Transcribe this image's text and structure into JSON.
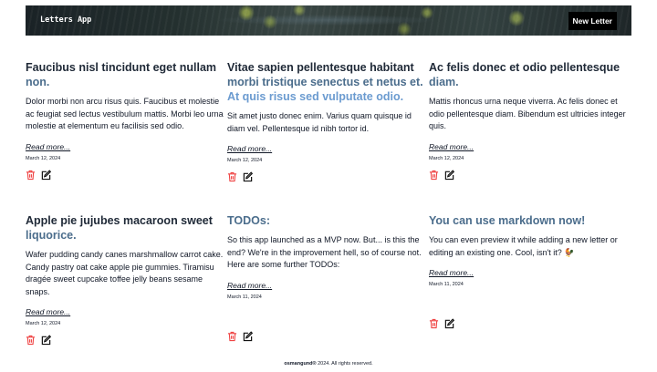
{
  "header": {
    "brand": "Letters App",
    "new_letter_label": "New Letter"
  },
  "letters": [
    {
      "title_lines": [
        {
          "text": "Faucibus nisl tincidunt eget nullam",
          "tone": "dark"
        },
        {
          "text": "non.",
          "tone": "blue"
        }
      ],
      "body": "Dolor morbi non arcu risus quis. Faucibus et molestie ac feugiat sed lectus vestibulum mattis. Morbi leo urna molestie at elementum eu facilisis sed odio.",
      "read_more": "Read more...",
      "date": "March 12, 2024",
      "delete_icon": "trash-icon",
      "edit_icon": "edit-icon"
    },
    {
      "title_lines": [
        {
          "text": "Vitae sapien pellentesque habitant",
          "tone": "dark"
        },
        {
          "text": "morbi tristique senectus et netus et.",
          "tone": "blue"
        },
        {
          "text": "At quis risus sed vulputate odio.",
          "tone": "light"
        }
      ],
      "body": "Sit amet justo donec enim. Varius quam quisque id diam vel. Pellentesque id nibh tortor id.",
      "read_more": "Read more...",
      "date": "March 12, 2024",
      "delete_icon": "trash-icon",
      "edit_icon": "edit-icon"
    },
    {
      "title_lines": [
        {
          "text": "Ac felis donec et odio pellentesque",
          "tone": "dark"
        },
        {
          "text": "diam.",
          "tone": "blue"
        }
      ],
      "body": "Mattis rhoncus urna neque viverra. Ac felis donec et odio pellentesque diam. Bibendum est ultricies integer quis.",
      "read_more": "Read more...",
      "date": "March 12, 2024",
      "delete_icon": "trash-icon",
      "edit_icon": "edit-icon"
    },
    {
      "title_lines": [
        {
          "text": "Apple pie jujubes macaroon sweet",
          "tone": "dark"
        },
        {
          "text": "liquorice.",
          "tone": "blue"
        }
      ],
      "body": "Wafer pudding candy canes marshmallow carrot cake. Candy pastry oat cake apple pie gummies. Tiramisu dragée sweet cupcake toffee jelly beans sesame snaps.",
      "read_more": "Read more...",
      "date": "March 12, 2024",
      "delete_icon": "trash-icon",
      "edit_icon": "edit-icon"
    },
    {
      "title_lines": [
        {
          "text": "TODOs:",
          "tone": "blue"
        }
      ],
      "body": "So this app launched as a MVP now. But... is this the end? We're in the improvement hell, so of course not. Here are some further TODOs:",
      "read_more": "Read more...",
      "date": "March 11, 2024",
      "delete_icon": "trash-icon",
      "edit_icon": "edit-icon"
    },
    {
      "title_lines": [
        {
          "text": "You can use markdown now!",
          "tone": "blue"
        }
      ],
      "body": "You can even preview it while adding a new letter or editing an existing one. Cool, isn't it? 🐓",
      "read_more": "Read more...",
      "date": "March 11, 2024",
      "delete_icon": "trash-icon",
      "edit_icon": "edit-icon"
    }
  ],
  "footer": {
    "owner": "osmangund®",
    "text": " 2024. All rights reserved."
  },
  "colors": {
    "delete": "#ef4444",
    "title_dark": "#1f2937",
    "title_blue": "#4b6d8c",
    "title_light": "#6b9bd0"
  }
}
